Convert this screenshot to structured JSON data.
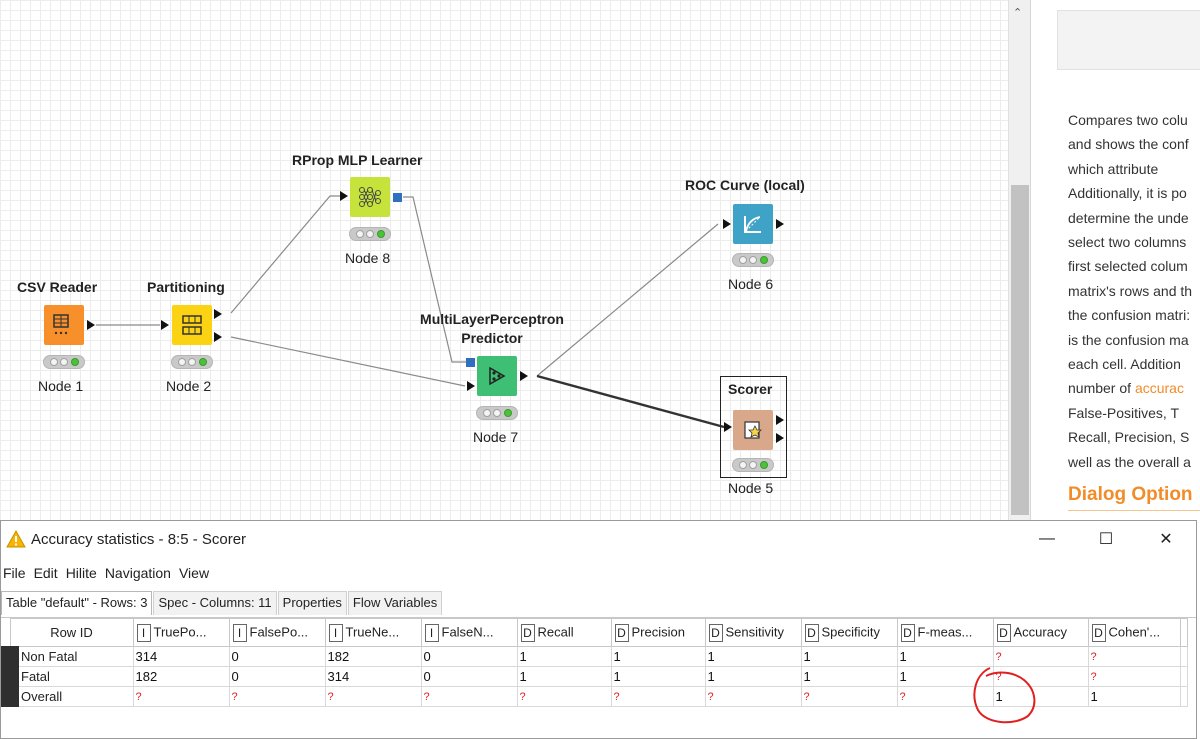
{
  "workflow": {
    "nodes": [
      {
        "id": "csv-reader",
        "title": "CSV Reader",
        "label": "Node 1",
        "color": "#f7902b"
      },
      {
        "id": "partitioning",
        "title": "Partitioning",
        "label": "Node 2",
        "color": "#fbd313"
      },
      {
        "id": "rprop",
        "title": "RProp MLP Learner",
        "label": "Node 8",
        "color": "#c6e33c"
      },
      {
        "id": "mlp-predictor",
        "title_line1": "MultiLayerPerceptron",
        "title_line2": "Predictor",
        "label": "Node 7",
        "color": "#3fbf73"
      },
      {
        "id": "roc",
        "title": "ROC Curve (local)",
        "label": "Node 6",
        "color": "#3fa3c8"
      },
      {
        "id": "scorer",
        "title": "Scorer",
        "label": "Node 5",
        "color": "#d9a88a"
      }
    ]
  },
  "description": {
    "lines": [
      "Compares two colu",
      "and shows the conf",
      "which    attribute",
      "Additionally, it is po",
      "determine the unde",
      "select two columns",
      "first selected colum",
      "matrix's rows and th",
      "the confusion matri:",
      "is the confusion ma",
      "each cell. Addition",
      "number of ",
      "False-Positives,    T",
      "Recall, Precision, S",
      "well as the overall a"
    ],
    "accuracy_link": "accurac",
    "dialog_heading": "Dialog Option"
  },
  "window": {
    "title": "Accuracy statistics - 8:5 - Scorer",
    "minimize": "—",
    "maximize": "☐",
    "close": "✕",
    "menu": [
      "File",
      "Edit",
      "Hilite",
      "Navigation",
      "View"
    ],
    "tabs": [
      "Table \"default\" - Rows: 3",
      "Spec - Columns: 11",
      "Properties",
      "Flow Variables"
    ]
  },
  "table": {
    "rowid_header": "Row ID",
    "columns": [
      {
        "type": "I",
        "name": "TruePo..."
      },
      {
        "type": "I",
        "name": "FalsePo..."
      },
      {
        "type": "I",
        "name": "TrueNe..."
      },
      {
        "type": "I",
        "name": "FalseN..."
      },
      {
        "type": "D",
        "name": "Recall"
      },
      {
        "type": "D",
        "name": "Precision"
      },
      {
        "type": "D",
        "name": "Sensitivity"
      },
      {
        "type": "D",
        "name": "Specificity"
      },
      {
        "type": "D",
        "name": "F-meas..."
      },
      {
        "type": "D",
        "name": "Accuracy"
      },
      {
        "type": "D",
        "name": "Cohen'..."
      }
    ],
    "rows": [
      {
        "id": "Non Fatal",
        "cells": [
          "314",
          "0",
          "182",
          "0",
          "1",
          "1",
          "1",
          "1",
          "1",
          "?",
          "?"
        ]
      },
      {
        "id": "Fatal",
        "cells": [
          "182",
          "0",
          "314",
          "0",
          "1",
          "1",
          "1",
          "1",
          "1",
          "?",
          "?"
        ]
      },
      {
        "id": "Overall",
        "cells": [
          "?",
          "?",
          "?",
          "?",
          "?",
          "?",
          "?",
          "?",
          "?",
          "1",
          "1"
        ]
      }
    ]
  },
  "colors": {
    "missing_value": "#e02020",
    "annotation_circle": "#e02020",
    "accent_orange": "#f28c28"
  }
}
